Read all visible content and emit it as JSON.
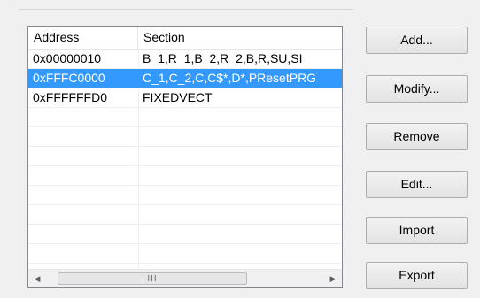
{
  "list": {
    "columns": [
      "Address",
      "Section"
    ],
    "rows": [
      {
        "address": "0x00000010",
        "section": "B_1,R_1,B_2,R_2,B,R,SU,SI"
      },
      {
        "address": "0xFFFC0000",
        "section": "C_1,C_2,C,C$*,D*,PResetPRG"
      },
      {
        "address": "0xFFFFFFD0",
        "section": "FIXEDVECT"
      }
    ],
    "selected_row": 1,
    "scrollbar": {
      "thumb_glyph": "III",
      "left_arrow": "◀",
      "right_arrow": "▶"
    }
  },
  "buttons": {
    "add": "Add...",
    "modify": "Modify...",
    "remove": "Remove",
    "edit": "Edit...",
    "import": "Import",
    "export": "Export"
  },
  "colors": {
    "selection": "#3399ff"
  }
}
